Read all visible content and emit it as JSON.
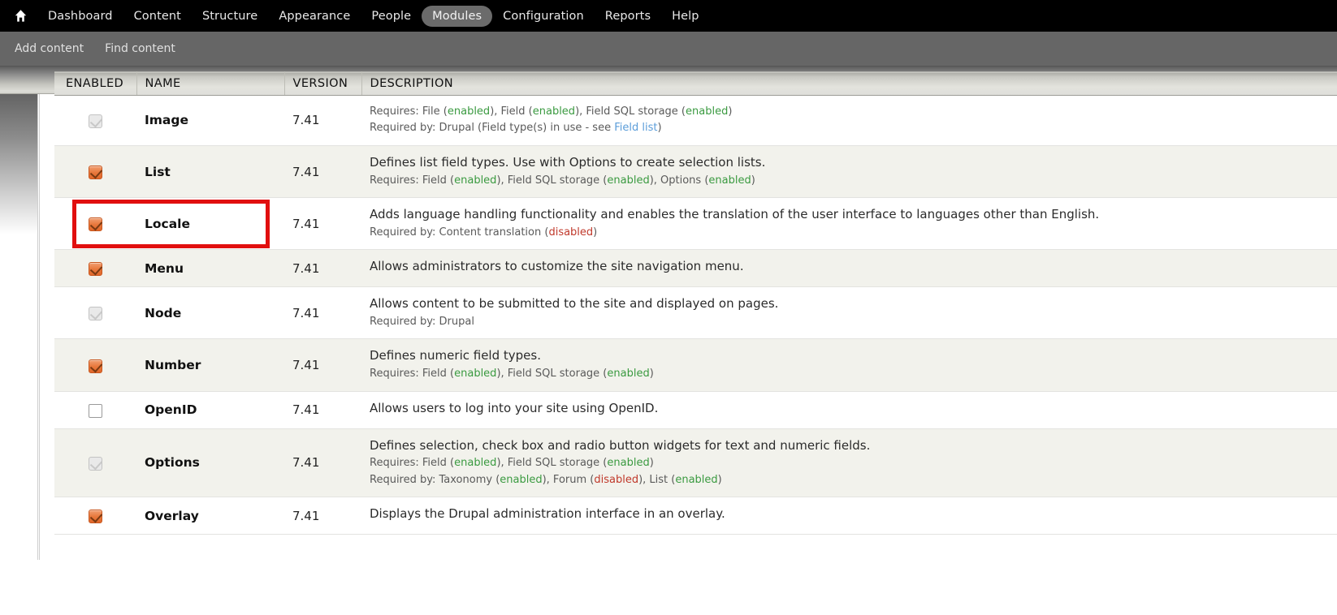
{
  "admin_menu": {
    "home_icon": "home-icon",
    "items": [
      {
        "label": "Dashboard",
        "active": false
      },
      {
        "label": "Content",
        "active": false
      },
      {
        "label": "Structure",
        "active": false
      },
      {
        "label": "Appearance",
        "active": false
      },
      {
        "label": "People",
        "active": false
      },
      {
        "label": "Modules",
        "active": true
      },
      {
        "label": "Configuration",
        "active": false
      },
      {
        "label": "Reports",
        "active": false
      },
      {
        "label": "Help",
        "active": false
      }
    ]
  },
  "sub_toolbar": {
    "items": [
      {
        "label": "Add content"
      },
      {
        "label": "Find content"
      }
    ]
  },
  "table": {
    "headers": {
      "enabled": "ENABLED",
      "name": "NAME",
      "version": "VERSION",
      "description": "DESCRIPTION"
    },
    "rows": [
      {
        "name": "Image",
        "version": "7.41",
        "checkbox": "disabled-checked",
        "stripe": "norm",
        "desc_main": "",
        "desc_lines": [
          {
            "prefix": "Requires: File (",
            "parts": [
              {
                "t": "enabled",
                "k": "en"
              },
              {
                "t": "), Field (",
                "k": "p"
              },
              {
                "t": "enabled",
                "k": "en"
              },
              {
                "t": "), Field SQL storage (",
                "k": "p"
              },
              {
                "t": "enabled",
                "k": "en"
              },
              {
                "t": ")",
                "k": "p"
              }
            ]
          },
          {
            "prefix": "Required by: Drupal (Field type(s) in use - see ",
            "parts": [
              {
                "t": "Field list",
                "k": "link"
              },
              {
                "t": ")",
                "k": "p"
              }
            ]
          }
        ]
      },
      {
        "name": "List",
        "version": "7.41",
        "checkbox": "checked",
        "stripe": "alt",
        "desc_main": "Defines list field types. Use with Options to create selection lists.",
        "desc_lines": [
          {
            "prefix": "Requires: Field (",
            "parts": [
              {
                "t": "enabled",
                "k": "en"
              },
              {
                "t": "), Field SQL storage (",
                "k": "p"
              },
              {
                "t": "enabled",
                "k": "en"
              },
              {
                "t": "), Options (",
                "k": "p"
              },
              {
                "t": "enabled",
                "k": "en"
              },
              {
                "t": ")",
                "k": "p"
              }
            ]
          }
        ]
      },
      {
        "name": "Locale",
        "version": "7.41",
        "checkbox": "checked",
        "stripe": "norm",
        "desc_main": "Adds language handling functionality and enables the translation of the user interface to languages other than English.",
        "desc_lines": [
          {
            "prefix": "Required by: Content translation (",
            "parts": [
              {
                "t": "disabled",
                "k": "dis"
              },
              {
                "t": ")",
                "k": "p"
              }
            ]
          }
        ]
      },
      {
        "name": "Menu",
        "version": "7.41",
        "checkbox": "checked",
        "stripe": "alt",
        "desc_main": "Allows administrators to customize the site navigation menu.",
        "desc_lines": []
      },
      {
        "name": "Node",
        "version": "7.41",
        "checkbox": "disabled-checked",
        "stripe": "norm",
        "desc_main": "Allows content to be submitted to the site and displayed on pages.",
        "desc_lines": [
          {
            "prefix": "Required by: Drupal",
            "parts": []
          }
        ]
      },
      {
        "name": "Number",
        "version": "7.41",
        "checkbox": "checked",
        "stripe": "alt",
        "desc_main": "Defines numeric field types.",
        "desc_lines": [
          {
            "prefix": "Requires: Field (",
            "parts": [
              {
                "t": "enabled",
                "k": "en"
              },
              {
                "t": "), Field SQL storage (",
                "k": "p"
              },
              {
                "t": "enabled",
                "k": "en"
              },
              {
                "t": ")",
                "k": "p"
              }
            ]
          }
        ]
      },
      {
        "name": "OpenID",
        "version": "7.41",
        "checkbox": "unchecked",
        "stripe": "norm",
        "desc_main": "Allows users to log into your site using OpenID.",
        "desc_lines": []
      },
      {
        "name": "Options",
        "version": "7.41",
        "checkbox": "disabled-checked",
        "stripe": "alt",
        "desc_main": "Defines selection, check box and radio button widgets for text and numeric fields.",
        "desc_lines": [
          {
            "prefix": "Requires: Field (",
            "parts": [
              {
                "t": "enabled",
                "k": "en"
              },
              {
                "t": "), Field SQL storage (",
                "k": "p"
              },
              {
                "t": "enabled",
                "k": "en"
              },
              {
                "t": ")",
                "k": "p"
              }
            ]
          },
          {
            "prefix": "Required by: Taxonomy (",
            "parts": [
              {
                "t": "enabled",
                "k": "en"
              },
              {
                "t": "), Forum (",
                "k": "p"
              },
              {
                "t": "disabled",
                "k": "dis"
              },
              {
                "t": "), List (",
                "k": "p"
              },
              {
                "t": "enabled",
                "k": "en"
              },
              {
                "t": ")",
                "k": "p"
              }
            ]
          }
        ]
      },
      {
        "name": "Overlay",
        "version": "7.41",
        "checkbox": "checked",
        "stripe": "norm",
        "desc_main": "Displays the Drupal administration interface in an overlay.",
        "desc_lines": []
      }
    ]
  },
  "annotation": {
    "target_row": "Locale",
    "color": "#e10f0f",
    "shape": "rectangle"
  },
  "colors": {
    "accent_orange": "#e8783c",
    "enabled_green": "#3a9a40",
    "disabled_red": "#c0392b",
    "link_blue": "#5b9dd9",
    "menu_black": "#000000",
    "toolbar_grey": "#666666",
    "row_alt": "#f2f2ec"
  }
}
